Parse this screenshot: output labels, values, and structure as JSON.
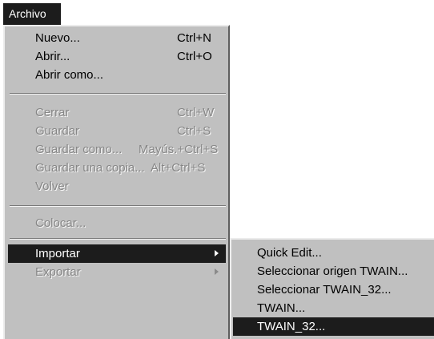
{
  "menubar": {
    "archivo": "Archivo"
  },
  "menu": {
    "nuevo": {
      "label": "Nuevo...",
      "shortcut": "Ctrl+N"
    },
    "abrir": {
      "label": "Abrir...",
      "shortcut": "Ctrl+O"
    },
    "abrir_como": {
      "label": "Abrir como..."
    },
    "cerrar": {
      "label": "Cerrar",
      "shortcut": "Ctrl+W"
    },
    "guardar": {
      "label": "Guardar",
      "shortcut": "Ctrl+S"
    },
    "guardar_como": {
      "label": "Guardar como...",
      "shortcut": "Mayús.+Ctrl+S"
    },
    "guardar_copia": {
      "label": "Guardar una copia...",
      "shortcut": "Alt+Ctrl+S"
    },
    "volver": {
      "label": "Volver"
    },
    "colocar": {
      "label": "Colocar..."
    },
    "importar": {
      "label": "Importar"
    },
    "exportar": {
      "label": "Exportar"
    }
  },
  "submenu": {
    "items": [
      "Quick Edit...",
      "Seleccionar origen TWAIN...",
      "Seleccionar TWAIN_32...",
      "TWAIN...",
      "TWAIN_32..."
    ]
  },
  "colors": {
    "menu_bg": "#c0c0c0",
    "highlight": "#1c1c1c",
    "disabled": "#868686"
  }
}
